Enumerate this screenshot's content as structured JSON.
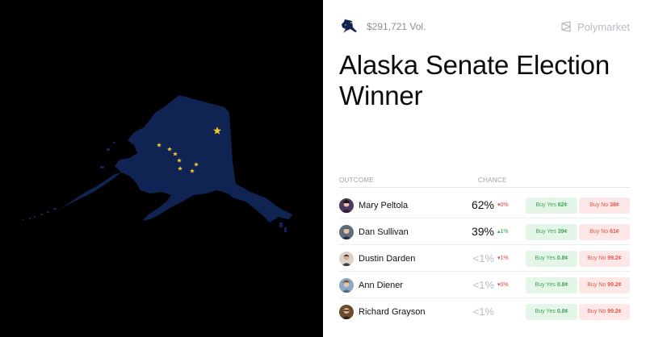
{
  "header": {
    "volume": "$291,721 Vol.",
    "brand": "Polymarket",
    "icons": {
      "market": "alaska-flag-map-icon",
      "brand": "polymarket-logo-icon"
    }
  },
  "market": {
    "title": "Alaska Senate Election Winner"
  },
  "table": {
    "columns": {
      "outcome": "OUTCOME",
      "chance": "CHANCE"
    },
    "rows": [
      {
        "name": "Mary Peltola",
        "chance": "62%",
        "change": "0%",
        "change_dir": "down",
        "buy_yes": "Buy Yes",
        "yes_price": "62¢",
        "buy_no": "Buy No",
        "no_price": "38¢"
      },
      {
        "name": "Dan Sullivan",
        "chance": "39%",
        "change": "1%",
        "change_dir": "up",
        "buy_yes": "Buy Yes",
        "yes_price": "39¢",
        "buy_no": "Buy No",
        "no_price": "61¢"
      },
      {
        "name": "Dustin Darden",
        "chance": "<1%",
        "change": "1%",
        "change_dir": "down",
        "buy_yes": "Buy Yes",
        "yes_price": "0.8¢",
        "buy_no": "Buy No",
        "no_price": "99.2¢"
      },
      {
        "name": "Ann Diener",
        "chance": "<1%",
        "change": "0%",
        "change_dir": "down",
        "buy_yes": "Buy Yes",
        "yes_price": "0.8¢",
        "buy_no": "Buy No",
        "no_price": "99.2¢"
      },
      {
        "name": "Richard Grayson",
        "chance": "<1%",
        "change": "",
        "change_dir": "none",
        "buy_yes": "Buy Yes",
        "yes_price": "0.8¢",
        "buy_no": "Buy No",
        "no_price": "99.2¢"
      }
    ]
  },
  "colors": {
    "flag_blue": "#0f2452",
    "star_gold": "#f4c430",
    "yes_green": "#44a35c",
    "no_red": "#e0564e"
  }
}
